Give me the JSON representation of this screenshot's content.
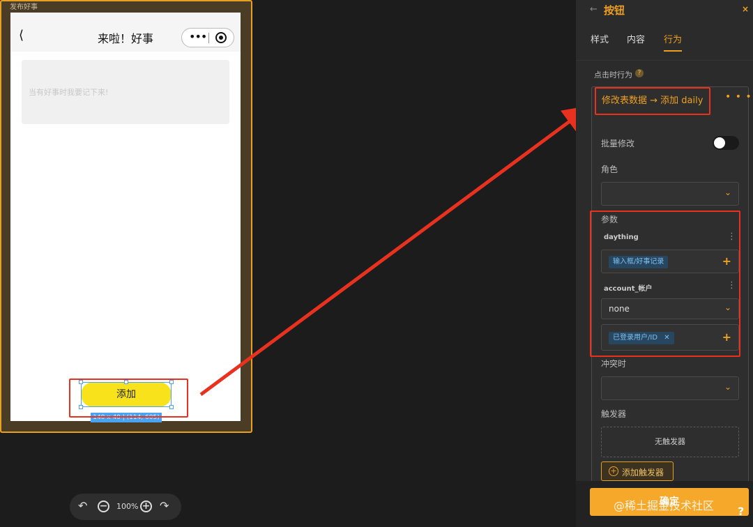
{
  "canvas": {
    "frame_title": "发布好事",
    "page_title": "来啦！好事",
    "back_icon": "chevron-left-icon",
    "textarea_placeholder": "当有好事时我要记下来!",
    "button_label": "添加",
    "dimension_label": "140 x 40 | (114, 605)"
  },
  "zoom": {
    "level": "100%"
  },
  "panel": {
    "back": "←",
    "title": "按钮",
    "close": "×",
    "tabs": [
      {
        "label": "样式",
        "active": false
      },
      {
        "label": "内容",
        "active": false
      },
      {
        "label": "行为",
        "active": true
      }
    ],
    "click_behavior_label": "点击时行为",
    "help": "?",
    "action": {
      "title": "修改表数据 → 添加 daily",
      "more": "• • •",
      "batch_label": "批量修改",
      "batch_enabled": false,
      "role_label": "角色",
      "params_label": "参数",
      "params": [
        {
          "name": "daything",
          "tag": "输入框/好事记录"
        },
        {
          "name": "account_帐户",
          "select": "none",
          "tag": "已登录用户/ID",
          "tag_close": "✕"
        }
      ],
      "conflict_label": "冲突时",
      "trigger_label": "触发器",
      "no_trigger": "无触发器",
      "add_trigger": "添加触发器"
    },
    "confirm": "确定"
  },
  "watermark": "@稀土掘金技术社区",
  "help_button": "?",
  "colors": {
    "accent": "#f0a020",
    "highlight": "#e8321f",
    "selection": "#4aa3f0",
    "button": "#f7e21b"
  }
}
